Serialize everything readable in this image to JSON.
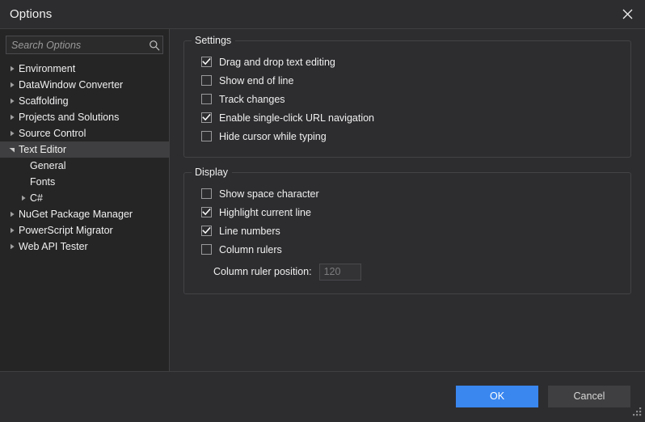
{
  "window": {
    "title": "Options",
    "close_icon": "close-icon"
  },
  "sidebar": {
    "search": {
      "placeholder": "Search Options",
      "value": "",
      "icon": "search-icon"
    },
    "items": [
      {
        "label": "Environment",
        "level": 0,
        "arrow": "collapsed",
        "selected": false
      },
      {
        "label": "DataWindow Converter",
        "level": 0,
        "arrow": "collapsed",
        "selected": false
      },
      {
        "label": "Scaffolding",
        "level": 0,
        "arrow": "collapsed",
        "selected": false
      },
      {
        "label": "Projects and Solutions",
        "level": 0,
        "arrow": "collapsed",
        "selected": false
      },
      {
        "label": "Source Control",
        "level": 0,
        "arrow": "collapsed",
        "selected": false
      },
      {
        "label": "Text Editor",
        "level": 0,
        "arrow": "expanded",
        "selected": true
      },
      {
        "label": "General",
        "level": 1,
        "arrow": "none",
        "selected": false
      },
      {
        "label": "Fonts",
        "level": 1,
        "arrow": "none",
        "selected": false
      },
      {
        "label": "C#",
        "level": 1,
        "arrow": "collapsed",
        "selected": false
      },
      {
        "label": "NuGet Package Manager",
        "level": 0,
        "arrow": "collapsed",
        "selected": false
      },
      {
        "label": "PowerScript Migrator",
        "level": 0,
        "arrow": "collapsed",
        "selected": false
      },
      {
        "label": "Web API Tester",
        "level": 0,
        "arrow": "collapsed",
        "selected": false
      }
    ]
  },
  "groups": [
    {
      "legend": "Settings",
      "checkboxes": [
        {
          "label": "Drag and drop text editing",
          "checked": true
        },
        {
          "label": "Show end of line",
          "checked": false
        },
        {
          "label": "Track changes",
          "checked": false
        },
        {
          "label": "Enable single-click URL navigation",
          "checked": true
        },
        {
          "label": "Hide cursor while typing",
          "checked": false
        }
      ]
    },
    {
      "legend": "Display",
      "checkboxes": [
        {
          "label": "Show space character",
          "checked": false
        },
        {
          "label": "Highlight current line",
          "checked": true
        },
        {
          "label": "Line numbers",
          "checked": true
        },
        {
          "label": "Column rulers",
          "checked": false
        }
      ],
      "field": {
        "label": "Column ruler position:",
        "value": "120",
        "disabled": true
      }
    }
  ],
  "footer": {
    "ok_label": "OK",
    "cancel_label": "Cancel",
    "ok_color": "#3a87f0",
    "cancel_color": "#3f3f41",
    "grip_icon": "resize-grip-icon"
  }
}
